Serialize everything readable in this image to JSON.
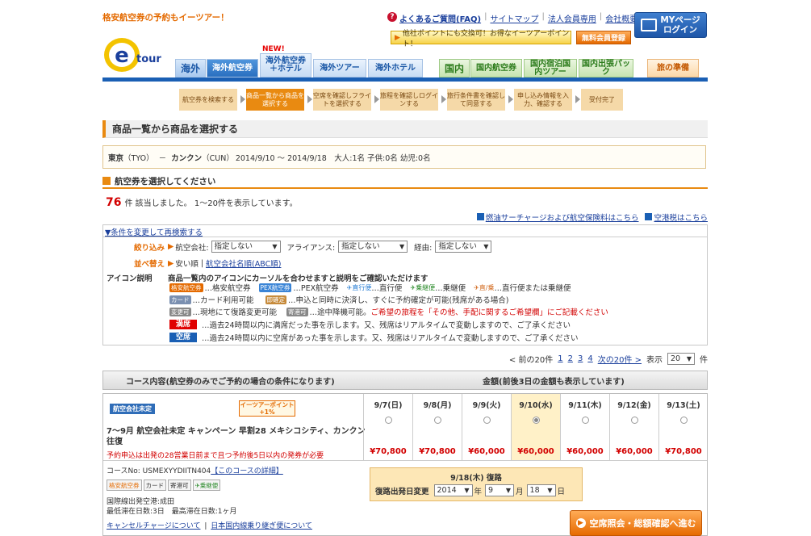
{
  "header": {
    "tagline": "格安航空券の予約もイーツアー！",
    "logo_text": "tour",
    "links": [
      "よくあるご質問(FAQ)",
      "サイトマップ",
      "法人会員専用",
      "会社概要"
    ],
    "mypage_label_1": "MYページ",
    "mypage_label_2": "ログイン",
    "promo": "他社ポイントにも交換可！お得なイーツアーポイント！",
    "member_register": "無料会員登録"
  },
  "nav": {
    "overseas_label": "海外",
    "new_badge": "NEW!",
    "tabs": [
      {
        "label": "海外航空券"
      },
      {
        "label": "海外航空券＋ホテル"
      },
      {
        "label": "海外ツアー"
      },
      {
        "label": "海外ホテル"
      }
    ],
    "domestic_label": "国内",
    "domestic_tabs": [
      {
        "label": "国内航空券"
      },
      {
        "label": "国内宿泊国内ツアー"
      },
      {
        "label": "国内出張パック"
      }
    ],
    "prep_label": "旅の準備"
  },
  "steps": [
    "航空券を検索する",
    "商品一覧から商品を選択する",
    "空席を確認しフライトを選択する",
    "旅程を確認しログインする",
    "旅行条件書を確認して同意する",
    "申し込み情報を入力、確認する",
    "受付完了"
  ],
  "page_title": "商品一覧から商品を選択する",
  "condition": {
    "origin": "東京",
    "origin_code": "（TYO）",
    "dash": "－",
    "dest": "カンクン",
    "dest_code": "（CUN）",
    "rest": "2014/9/10 ～ 2014/9/18　大人:1名 子供:0名 幼児:0名"
  },
  "section_title": "航空券を選択してください",
  "result": {
    "count": "76",
    "text": "件 該当しました。 1～20件を表示しています。"
  },
  "info_links": [
    "燃油サーチャージおよび航空保険料はこちら",
    "空港税はこちら"
  ],
  "filter": {
    "change_link": "▼条件を変更して再検索する",
    "narrow_label": "絞り込み",
    "airline_label": "航空会社:",
    "airline_value": "指定しない",
    "alliance_label": "アライアンス:",
    "alliance_value": "指定しない",
    "via_label": "経由:",
    "via_value": "指定しない",
    "sort_label": "並べ替え",
    "sort_cheap": "安い順",
    "sort_sep": "|",
    "sort_airline": "航空会社名順(ABC順)",
    "icon_label": "アイコン説明",
    "icon_intro": "商品一覧内のアイコンにカーソルを合わせますと説明をご確認いただけます",
    "icon_lines": [
      "…格安航空券",
      "…PEX航空券",
      "…直行便",
      "…乗継便",
      "…直行便または乗継便",
      "…カード利用可能",
      "…申込と同時に決済し、すぐに予約確定が可能(残席がある場合)",
      "…現地にて復路変更可能",
      "…途中降機可能。",
      "ご希望の旅程を「その他、手配に関するご希望欄」にご記載ください",
      "…過去24時間以内に満席だった事を示します。又、残席はリアルタイムで変動しますので、ご了承ください",
      "…過去24時間以内に空席があった事を示します。又、残席はリアルタイムで変動しますので、ご了承ください"
    ],
    "tag_labels": {
      "cheap": "格安航空券",
      "pex": "PEX航空券",
      "direct": "直行便",
      "transfer": "乗継便",
      "both": "直/乗",
      "card": "カード",
      "instant": "即確定",
      "change": "変更可",
      "stopover": "寄港可"
    },
    "full_label": "満席",
    "vacant_label": "空席"
  },
  "pager": {
    "prev": "< 前の20件",
    "pages": [
      "1",
      "2",
      "3",
      "4"
    ],
    "next": "次の20件 >",
    "display_label": "表示",
    "display_value": "20",
    "unit": "件"
  },
  "table_header": {
    "course": "コース内容(航空券のみでご予約の場合の条件になります)",
    "price": "金額(前後3日の金額も表示しています)"
  },
  "course": {
    "airline_tag": "航空会社未定",
    "point_tag": "イーツアーポイント+1%",
    "title": "7～9月 航空会社未定 キャンペーン 早割28 メキシコシティ、カンクン 往復",
    "note": "予約申込は出発の28営業日前まで且つ予約後5日以内の発券が必要",
    "code_label": "コースNo: USMEXYYDIITN404",
    "detail_link": "【このコースの詳細】",
    "departure_airport": "国際線出発空港:成田",
    "stay": "最低滞在日数:3日　最高滞在日数:1ヶ月",
    "cancel_link": "キャンセルチャージについて",
    "sep": "|",
    "domestic_link": "日本国内線乗り継ぎ便について",
    "dates": [
      {
        "date": "9/7(日)",
        "price": "¥70,800"
      },
      {
        "date": "9/8(月)",
        "price": "¥70,800"
      },
      {
        "date": "9/9(火)",
        "price": "¥60,000"
      },
      {
        "date": "9/10(水)",
        "price": "¥60,000"
      },
      {
        "date": "9/11(木)",
        "price": "¥60,000"
      },
      {
        "date": "9/12(金)",
        "price": "¥60,000"
      },
      {
        "date": "9/13(土)",
        "price": "¥70,800"
      }
    ],
    "return_title": "9/18(木) 復路",
    "return_change_label": "復路出発日変更",
    "return_year": "2014",
    "year_unit": "年",
    "return_month": "9",
    "month_unit": "月",
    "return_day": "18",
    "day_unit": "日",
    "confirm_button": "空席照会・総額確認へ進む"
  },
  "colors": {
    "accent": "#e98a11",
    "brand_blue": "#1a5fb4",
    "price_red": "#d20000"
  }
}
